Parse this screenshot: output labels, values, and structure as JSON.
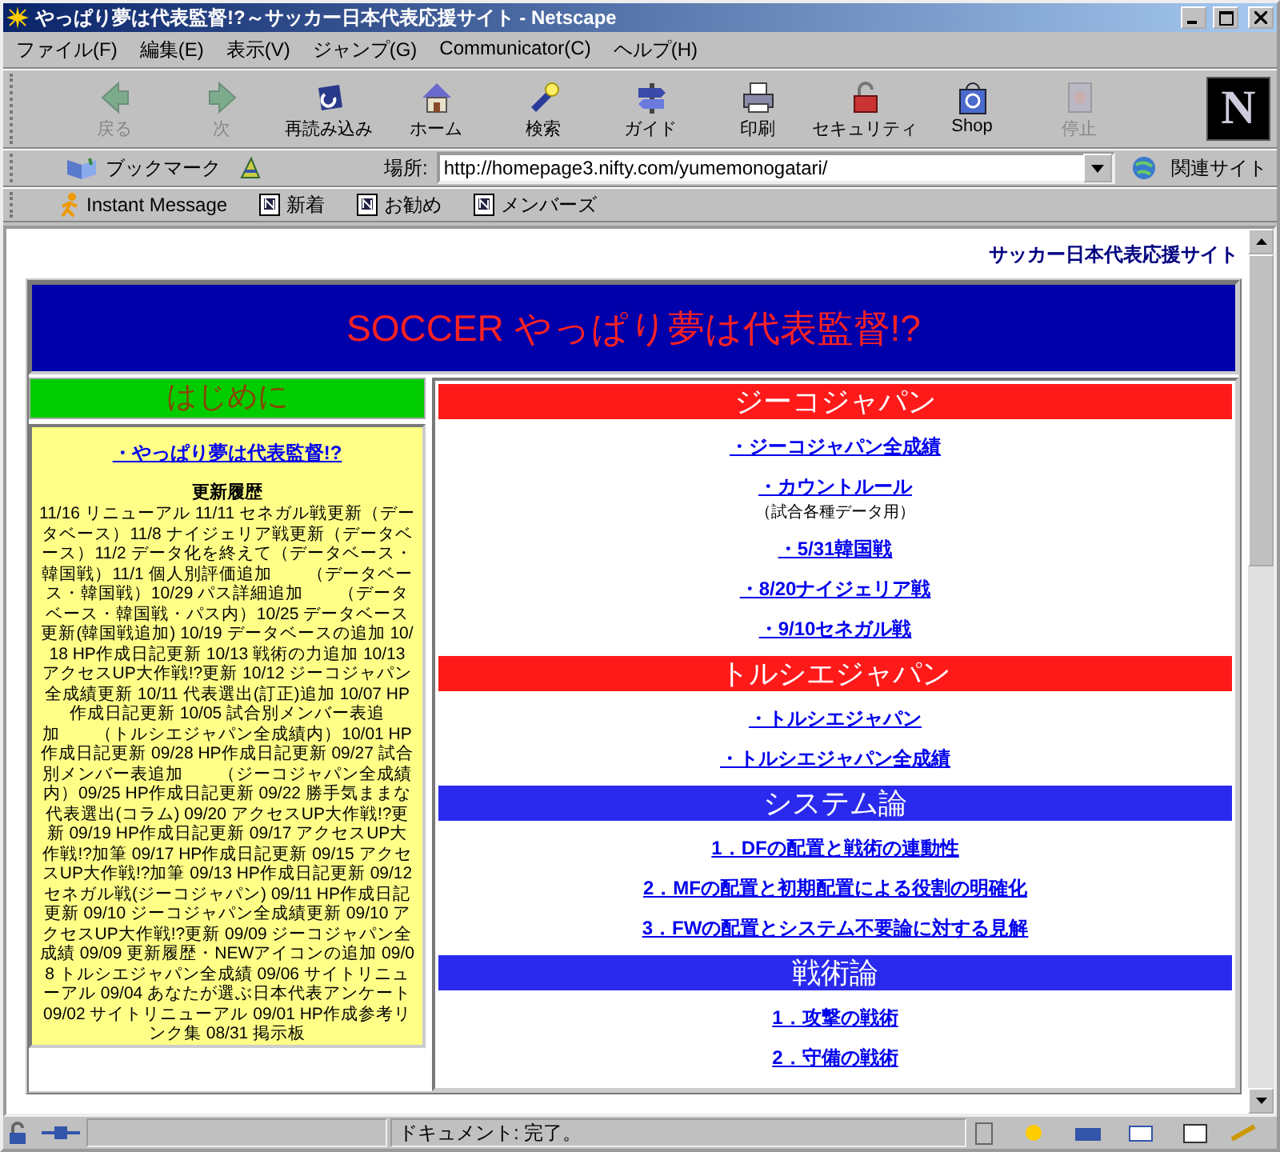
{
  "window": {
    "title": "やっぱり夢は代表監督!?～サッカー日本代表応援サイト - Netscape"
  },
  "menu": [
    "ファイル(F)",
    "編集(E)",
    "表示(V)",
    "ジャンプ(G)",
    "Communicator(C)",
    "ヘルプ(H)"
  ],
  "toolbar": [
    {
      "label": "戻る",
      "disabled": true
    },
    {
      "label": "次",
      "disabled": true
    },
    {
      "label": "再読み込み",
      "disabled": false
    },
    {
      "label": "ホーム",
      "disabled": false
    },
    {
      "label": "検索",
      "disabled": false
    },
    {
      "label": "ガイド",
      "disabled": false
    },
    {
      "label": "印刷",
      "disabled": false
    },
    {
      "label": "セキュリティ",
      "disabled": false
    },
    {
      "label": "Shop",
      "disabled": false
    },
    {
      "label": "停止",
      "disabled": true
    }
  ],
  "logo": "N",
  "location_bar": {
    "bookmarks": "ブックマーク",
    "label": "場所:",
    "url": "http://homepage3.nifty.com/yumemonogatari/",
    "related": "関連サイト"
  },
  "personal_bar": [
    "Instant Message",
    "新着",
    "お勧め",
    "メンバーズ"
  ],
  "page": {
    "site_name": "サッカー日本代表応援サイト",
    "banner": "SOCCER やっぱり夢は代表監督!?",
    "intro": {
      "header": "はじめに",
      "link": "・やっぱり夢は代表監督!?",
      "history_title": "更新履歴",
      "history_text": "11/16 リニューアル 11/11 セネガル戦更新（データベース）11/8 ナイジェリア戦更新（データベース）11/2 データ化を終えて（データベース・韓国戦）11/1 個人別評価追加　　（データベース・韓国戦）10/29 パス詳細追加　　（データベース・韓国戦・パス内）10/25 データベース更新(韓国戦追加) 10/19 データベースの追加 10/18 HP作成日記更新 10/13 戦術の力追加 10/13 アクセスUP大作戦!?更新 10/12 ジーコジャパン全成績更新 10/11 代表選出(訂正)追加 10/07 HP作成日記更新 10/05 試合別メンバー表追加　　（トルシエジャパン全成績内）10/01 HP作成日記更新 09/28 HP作成日記更新 09/27 試合別メンバー表追加　　（ジーコジャパン全成績内）09/25 HP作成日記更新 09/22 勝手気ままな代表選出(コラム) 09/20 アクセスUP大作戦!?更新 09/19 HP作成日記更新 09/17 アクセスUP大作戦!?加筆 09/17 HP作成日記更新 09/15 アクセスUP大作戦!?加筆 09/13 HP作成日記更新 09/12 セネガル戦(ジーコジャパン) 09/11 HP作成日記更新 09/10 ジーコジャパン全成績更新 09/10 アクセスUP大作戦!?更新 09/09 ジーコジャパン全成績 09/09 更新履歴・NEWアイコンの追加 09/08 トルシエジャパン全成績 09/06 サイトリニューアル 09/04 あなたが選ぶ日本代表アンケート 09/02 サイトリニューアル 09/01 HP作成参考リンク集 08/31 掲示板"
    },
    "sections": [
      {
        "title": "ジーコジャパン",
        "color": "#ff1a1a",
        "links": [
          {
            "text": "・ジーコジャパン全成績"
          },
          {
            "text": "・カウントルール",
            "note": "（試合各種データ用）"
          },
          {
            "text": "・5/31韓国戦"
          },
          {
            "text": "・8/20ナイジェリア戦"
          },
          {
            "text": "・9/10セネガル戦"
          }
        ]
      },
      {
        "title": "トルシエジャパン",
        "color": "#ff1a1a",
        "links": [
          {
            "text": "・トルシエジャパン"
          },
          {
            "text": "・トルシエジャパン全成績"
          }
        ]
      },
      {
        "title": "システム論",
        "color": "#2a2aee",
        "links": [
          {
            "text": "1．DFの配置と戦術の連動性"
          },
          {
            "text": "2．MFの配置と初期配置による役割の明確化"
          },
          {
            "text": "3．FWの配置とシステム不要論に対する見解"
          }
        ]
      },
      {
        "title": "戦術論",
        "color": "#2a2aee",
        "links": [
          {
            "text": "1．攻撃の戦術"
          },
          {
            "text": "2．守備の戦術"
          }
        ]
      }
    ]
  },
  "status": "ドキュメント: 完了。"
}
